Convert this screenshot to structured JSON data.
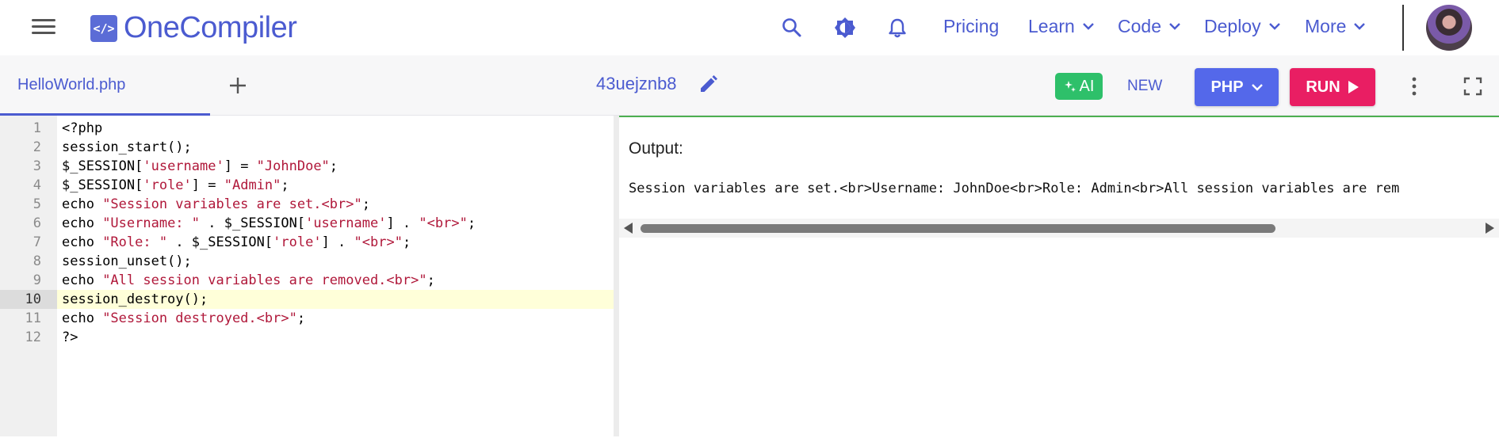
{
  "brand": {
    "logo_glyph": "</>",
    "name": "OneCompiler",
    "color": "#4b5bd0"
  },
  "nav": {
    "icons": [
      "search-icon",
      "theme-toggle-icon",
      "notifications-icon"
    ],
    "pricing": "Pricing",
    "learn": "Learn",
    "code": "Code",
    "deploy": "Deploy",
    "more": "More"
  },
  "toolbar": {
    "file_tab": "HelloWorld.php",
    "project_name": "43uejznb8",
    "ai_label": "AI",
    "new_label": "NEW",
    "language": "PHP",
    "run_label": "RUN",
    "colors": {
      "ai": "#2ec06a",
      "language": "#5468ea",
      "run": "#e91e63"
    }
  },
  "editor": {
    "active_line": 10,
    "lines": [
      {
        "n": "1",
        "parts": [
          {
            "t": "<?php",
            "s": false
          }
        ]
      },
      {
        "n": "2",
        "parts": [
          {
            "t": "session_start();",
            "s": false
          }
        ]
      },
      {
        "n": "3",
        "parts": [
          {
            "t": "$_SESSION[",
            "s": false
          },
          {
            "t": "'username'",
            "s": true
          },
          {
            "t": "] = ",
            "s": false
          },
          {
            "t": "\"JohnDoe\"",
            "s": true
          },
          {
            "t": ";",
            "s": false
          }
        ]
      },
      {
        "n": "4",
        "parts": [
          {
            "t": "$_SESSION[",
            "s": false
          },
          {
            "t": "'role'",
            "s": true
          },
          {
            "t": "] = ",
            "s": false
          },
          {
            "t": "\"Admin\"",
            "s": true
          },
          {
            "t": ";",
            "s": false
          }
        ]
      },
      {
        "n": "5",
        "parts": [
          {
            "t": "echo ",
            "s": false
          },
          {
            "t": "\"Session variables are set.<br>\"",
            "s": true
          },
          {
            "t": ";",
            "s": false
          }
        ]
      },
      {
        "n": "6",
        "parts": [
          {
            "t": "echo ",
            "s": false
          },
          {
            "t": "\"Username: \"",
            "s": true
          },
          {
            "t": " . $_SESSION[",
            "s": false
          },
          {
            "t": "'username'",
            "s": true
          },
          {
            "t": "] . ",
            "s": false
          },
          {
            "t": "\"<br>\"",
            "s": true
          },
          {
            "t": ";",
            "s": false
          }
        ]
      },
      {
        "n": "7",
        "parts": [
          {
            "t": "echo ",
            "s": false
          },
          {
            "t": "\"Role: \"",
            "s": true
          },
          {
            "t": " . $_SESSION[",
            "s": false
          },
          {
            "t": "'role'",
            "s": true
          },
          {
            "t": "] . ",
            "s": false
          },
          {
            "t": "\"<br>\"",
            "s": true
          },
          {
            "t": ";",
            "s": false
          }
        ]
      },
      {
        "n": "8",
        "parts": [
          {
            "t": "session_unset();",
            "s": false
          }
        ]
      },
      {
        "n": "9",
        "parts": [
          {
            "t": "echo ",
            "s": false
          },
          {
            "t": "\"All session variables are removed.<br>\"",
            "s": true
          },
          {
            "t": ";",
            "s": false
          }
        ]
      },
      {
        "n": "10",
        "parts": [
          {
            "t": "session_destroy();",
            "s": false
          }
        ]
      },
      {
        "n": "11",
        "parts": [
          {
            "t": "echo ",
            "s": false
          },
          {
            "t": "\"Session destroyed.<br>\"",
            "s": true
          },
          {
            "t": ";",
            "s": false
          }
        ]
      },
      {
        "n": "12",
        "parts": [
          {
            "t": "?>",
            "s": false
          }
        ]
      }
    ]
  },
  "output": {
    "label": "Output:",
    "text": "Session variables are set.<br>Username: JohnDoe<br>Role: Admin<br>All session variables are rem"
  }
}
